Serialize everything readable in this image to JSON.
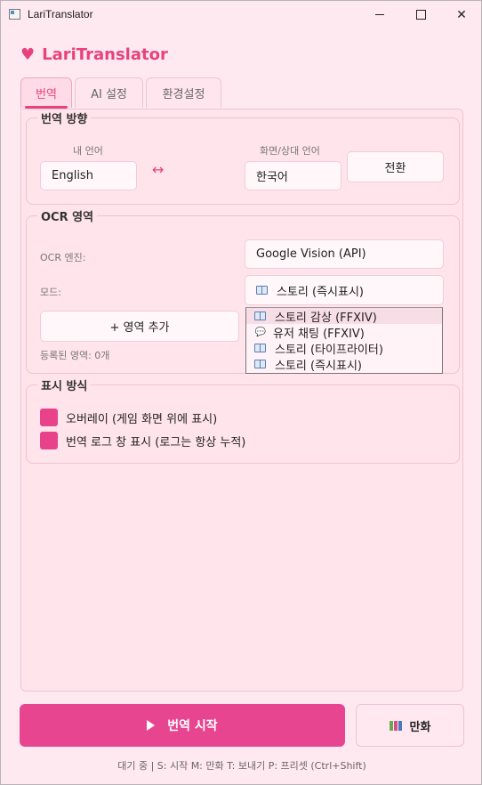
{
  "window": {
    "title": "LariTranslator"
  },
  "brand": {
    "name": "LariTranslator"
  },
  "tabs": [
    {
      "label": "번역",
      "active": true
    },
    {
      "label": "AI 설정",
      "active": false
    },
    {
      "label": "환경설정",
      "active": false
    }
  ],
  "direction": {
    "title": "번역 방향",
    "my_lang_label": "내 언어",
    "my_lang_value": "English",
    "swap_glyph": "↔",
    "target_lang_label": "화면/상대 언어",
    "target_lang_value": "한국어",
    "switch_button": "전환"
  },
  "ocr": {
    "title": "OCR 영역",
    "engine_label": "OCR 엔진:",
    "engine_value": "Google Vision (API)",
    "mode_label": "모드:",
    "mode_value": "스토리 (즉시표시)",
    "add_region_button": "+ 영역 추가",
    "registered_text": "등록된 영역: 0개",
    "mode_options": [
      {
        "label": "스토리 감상 (FFXIV)",
        "icon": "book-icon",
        "highlighted": true
      },
      {
        "label": "유저 채팅 (FFXIV)",
        "icon": "chat-bubble-icon",
        "highlighted": false
      },
      {
        "label": "스토리 (타이프라이터)",
        "icon": "book-icon",
        "highlighted": false
      },
      {
        "label": "스토리 (즉시표시)",
        "icon": "book-icon",
        "highlighted": false
      }
    ]
  },
  "display": {
    "title": "표시 방식",
    "overlay_label": "오버레이 (게임 화면 위에 표시)",
    "overlay_checked": true,
    "log_label": "번역 로그 창 표시 (로그는 항상 누적)",
    "log_checked": true
  },
  "actions": {
    "start_label": "번역 시작",
    "manga_label": "만화"
  },
  "status": {
    "text": "대기 중  |  S: 시작  M: 만화  T: 보내기  P: 프리셋  (Ctrl+Shift)"
  },
  "colors": {
    "accent": "#e8427c",
    "background": "#ffe9f0",
    "start_button": "#e84590"
  }
}
